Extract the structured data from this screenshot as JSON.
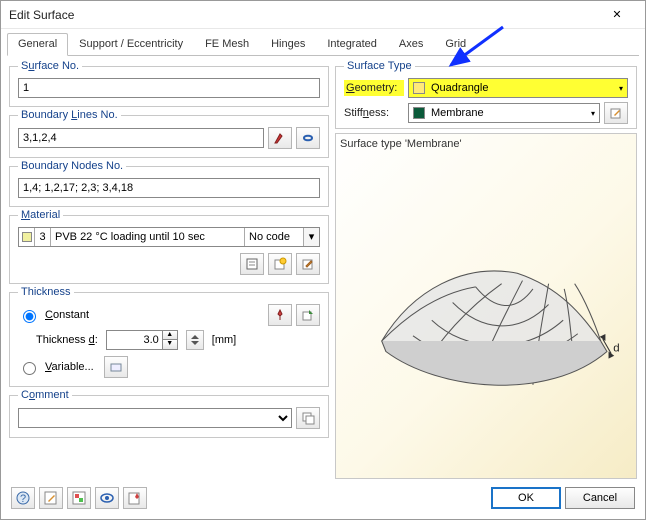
{
  "window": {
    "title": "Edit Surface"
  },
  "tabs": [
    "General",
    "Support / Eccentricity",
    "FE Mesh",
    "Hinges",
    "Integrated",
    "Axes",
    "Grid"
  ],
  "active_tab": 0,
  "left": {
    "surface_no": {
      "legend_pre": "S",
      "legend_u": "u",
      "legend_post": "rface No.",
      "value": "1"
    },
    "boundary_lines": {
      "legend_pre": "Boundary ",
      "legend_u": "L",
      "legend_post": "ines No.",
      "value": "3,1,2,4"
    },
    "boundary_nodes": {
      "legend": "Boundary Nodes No.",
      "value": "1,4; 1,2,17; 2,3; 3,4,18"
    },
    "material": {
      "legend_u": "M",
      "legend_post": "aterial",
      "id": "3",
      "name": "PVB 22 °C loading until 10 sec",
      "code": "No code"
    },
    "thickness": {
      "legend": "Thickness",
      "constant_pre": "",
      "constant_u": "C",
      "constant_post": "onstant",
      "constant_checked": true,
      "d_label_pre": "Thickness ",
      "d_label_u": "d",
      "d_label_post": ":",
      "d_value": "3.0",
      "d_unit": "[mm]",
      "variable_pre": "",
      "variable_u": "V",
      "variable_post": "ariable...",
      "variable_checked": false
    },
    "comment": {
      "legend_pre": "C",
      "legend_u": "o",
      "legend_post": "mment",
      "value": ""
    }
  },
  "right": {
    "legend": "Surface Type",
    "geometry_label_u": "G",
    "geometry_label_post": "eometry:",
    "geometry_value": "Quadrangle",
    "stiffness_label_pre": "Stiff",
    "stiffness_label_u": "n",
    "stiffness_label_post": "ess:",
    "stiffness_value": "Membrane",
    "preview_caption": "Surface type 'Membrane'",
    "d_annotation": "d"
  },
  "footer": {
    "ok": "OK",
    "cancel": "Cancel"
  },
  "icons": {
    "close": "✕",
    "pick": "pk",
    "select": "sel",
    "lib": "lib",
    "new": "new",
    "edit": "ed",
    "pin": "pin",
    "exp": "exp",
    "var": "var",
    "copy": "cp",
    "help": "?",
    "f2": "f2",
    "f3": "f3",
    "eye": "eye",
    "f5": "f5"
  }
}
